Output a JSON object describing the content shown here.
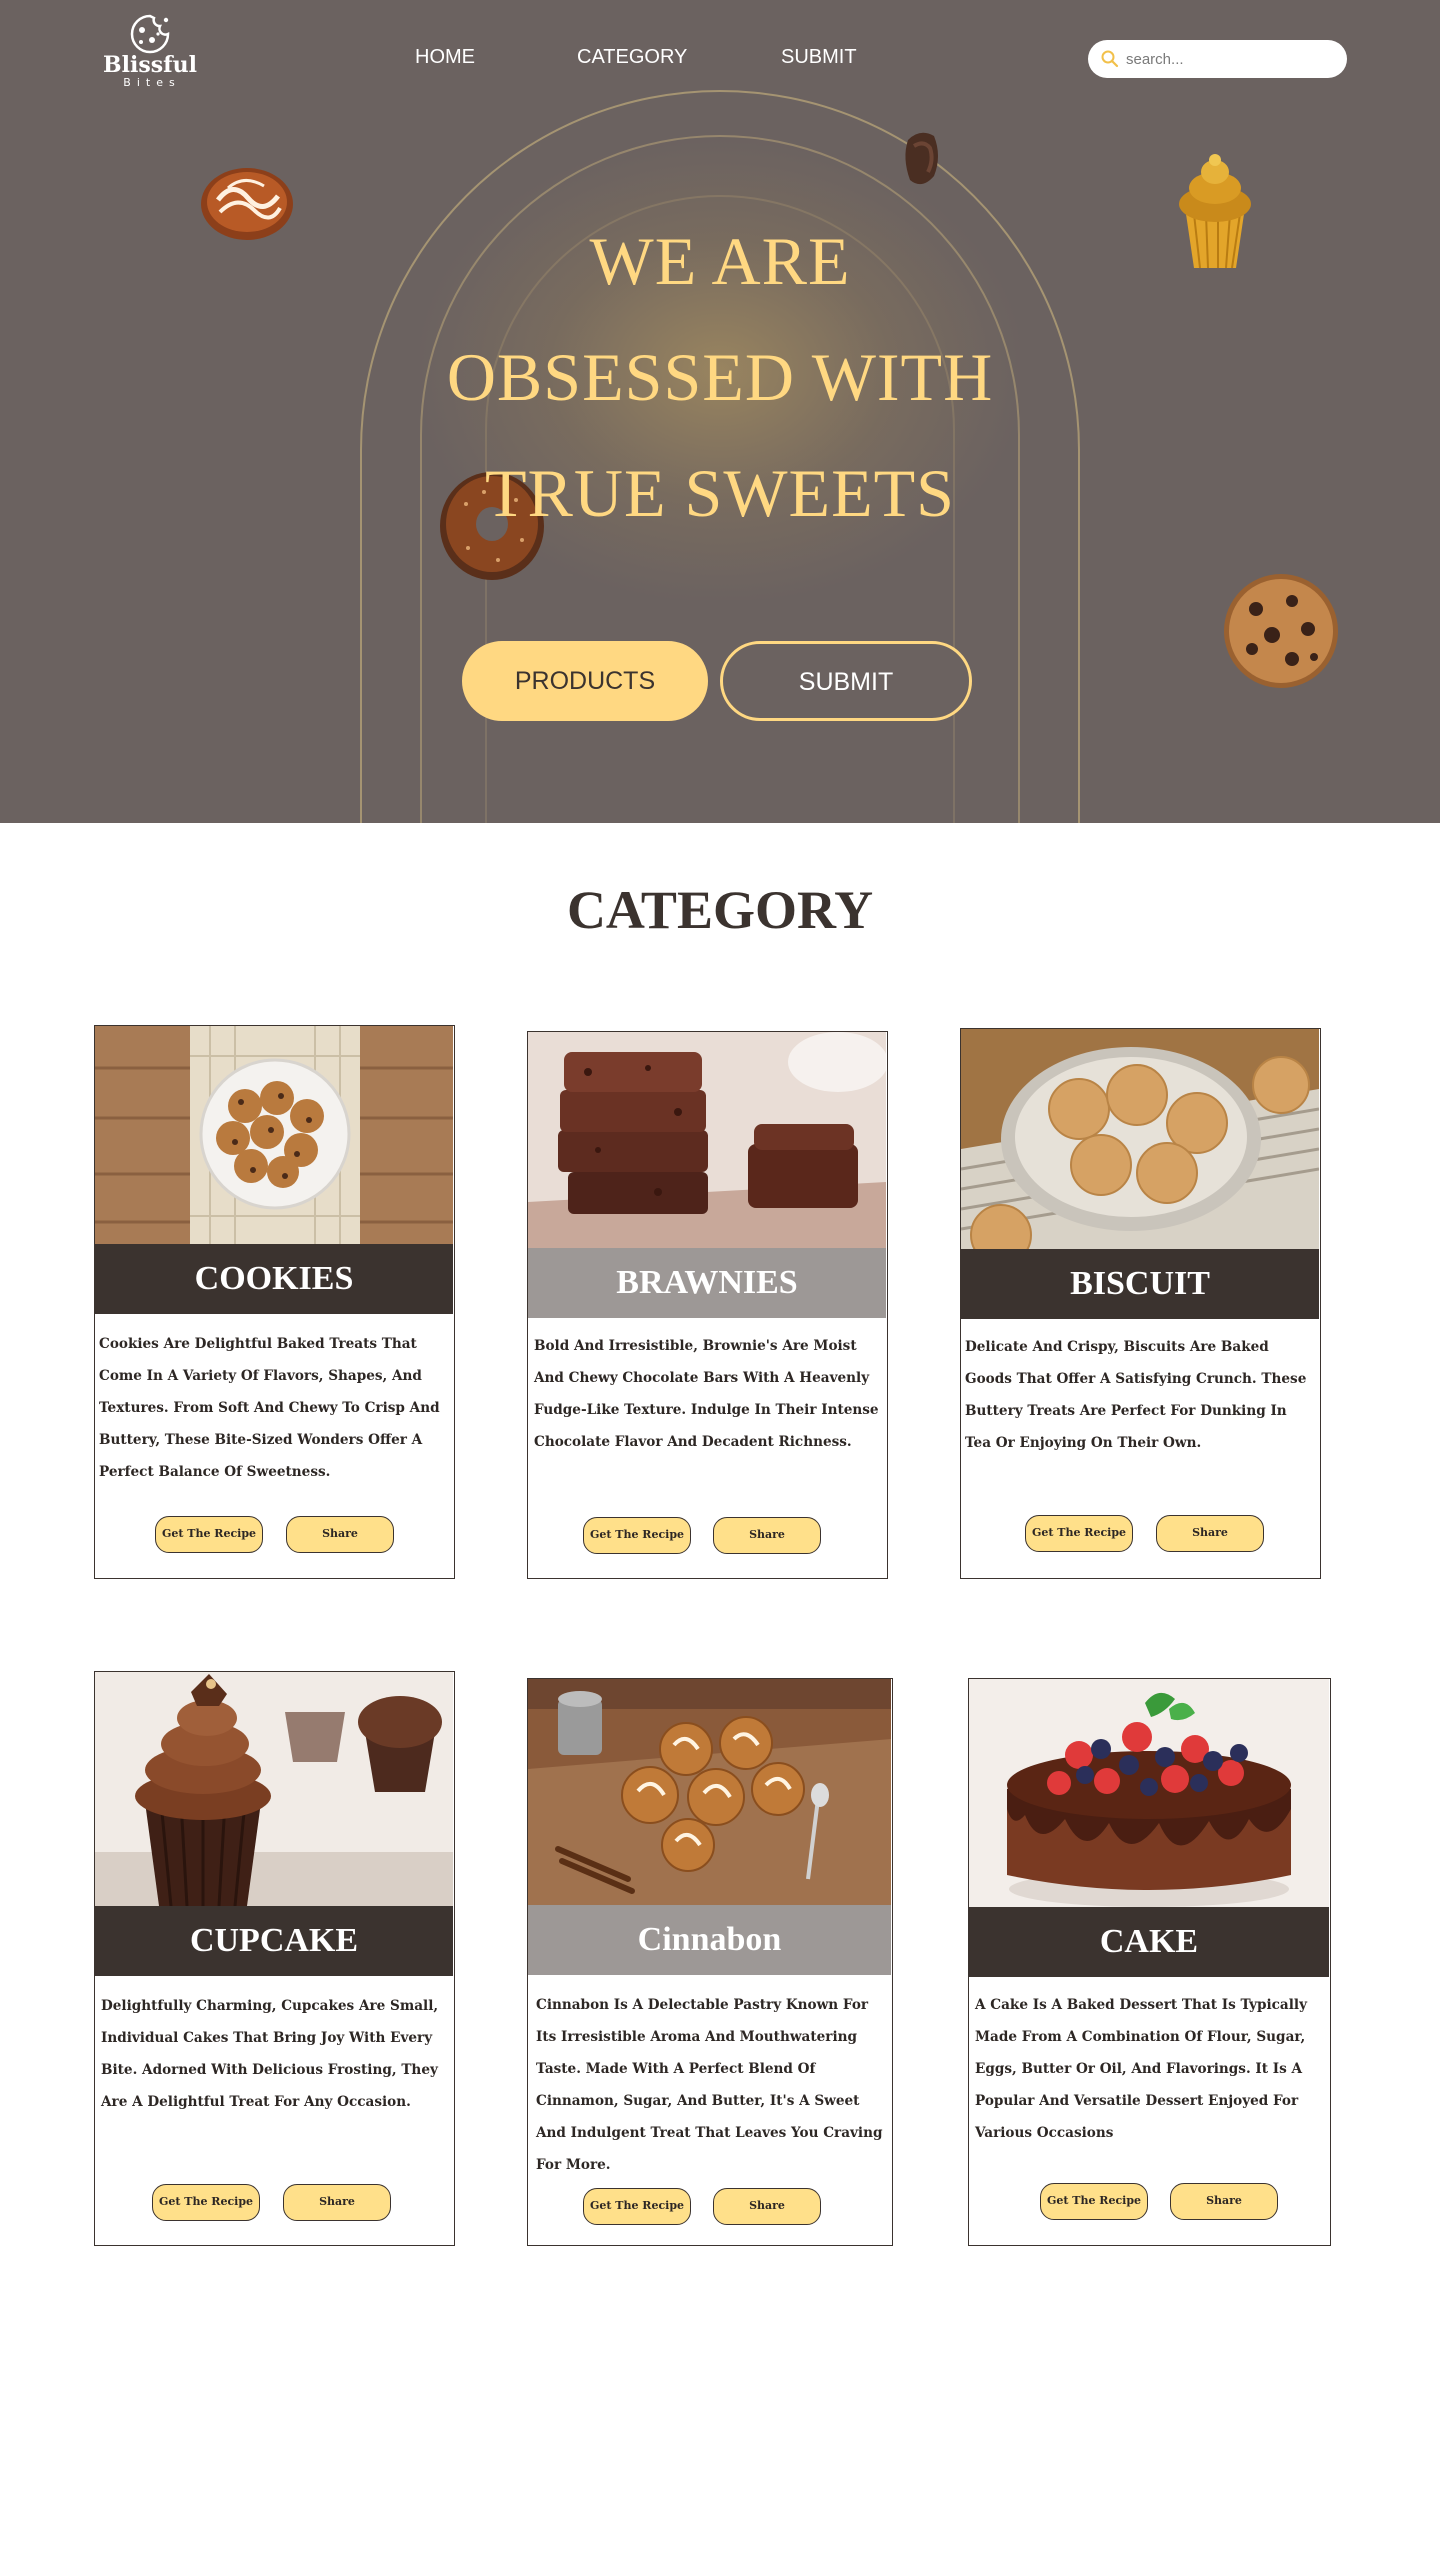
{
  "header": {
    "logo": {
      "name": "Blissful",
      "sub": "Bites"
    },
    "nav": [
      "HOME",
      "CATEGORY",
      "SUBMIT"
    ],
    "search_placeholder": "search..."
  },
  "hero": {
    "lines": [
      "WE ARE",
      "OBSESSED WITH",
      "TRUE SWEETS"
    ],
    "primary_button": "PRODUCTS",
    "secondary_button": "SUBMIT"
  },
  "category": {
    "title": "CATEGORY",
    "recipe_label": "Get The Recipe",
    "share_label": "Share",
    "cards": [
      {
        "name": "COOKIES",
        "image": "cookies-plate-photo",
        "desc": "Cookies Are Delightful Baked Treats That Come In A Variety Of Flavors, Shapes, And Textures. From Soft And Chewy To Crisp And Buttery, These Bite-Sized Wonders Offer A Perfect Balance Of Sweetness."
      },
      {
        "name": "BRAWNIES",
        "image": "brownie-stack-photo",
        "desc": "Bold And Irresistible, Brownie's Are Moist And Chewy Chocolate Bars With A Heavenly Fudge-Like Texture. Indulge In Their Intense Chocolate Flavor And Decadent Richness."
      },
      {
        "name": "BISCUIT",
        "image": "biscuits-plate-photo",
        "desc": "Delicate And Crispy, Biscuits Are Baked Goods That Offer A Satisfying Crunch. These Buttery Treats Are Perfect For Dunking In Tea Or Enjoying On Their Own."
      },
      {
        "name": "CUPCAKE",
        "image": "chocolate-cupcake-photo",
        "desc": "Delightfully Charming, Cupcakes Are Small, Individual Cakes That Bring Joy With Every Bite. Adorned With Delicious Frosting, They Are A Delightful Treat For Any Occasion."
      },
      {
        "name": "Cinnabon",
        "image": "cinnamon-rolls-photo",
        "desc": "Cinnabon Is A Delectable Pastry Known For Its Irresistible Aroma And Mouthwatering Taste. Made With A Perfect Blend Of Cinnamon, Sugar, And Butter, It's A Sweet And Indulgent Treat That Leaves You Craving For More."
      },
      {
        "name": "CAKE",
        "image": "berry-chocolate-cake-photo",
        "desc": "A Cake Is A Baked Dessert That Is Typically Made From A Combination Of Flour, Sugar, Eggs, Butter Or Oil, And Flavorings. It Is A Popular And Versatile Dessert Enjoyed For Various Occasions"
      }
    ]
  },
  "colors": {
    "hero_bg": "#6b6260",
    "accent": "#ffd882",
    "dark": "#3b332f",
    "band_grey": "#9d9896",
    "button_yellow": "#ffe08a"
  }
}
